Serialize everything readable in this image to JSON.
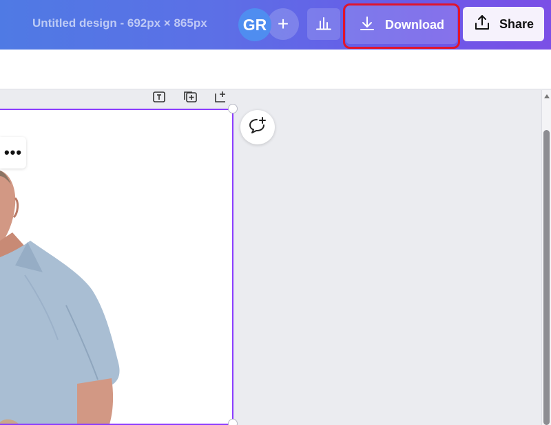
{
  "header": {
    "doc_title": "Untitled design - 692px × 865px",
    "avatar_initials": "GR",
    "add_label": "+",
    "download_label": "Download",
    "share_label": "Share"
  },
  "canvas": {
    "more_label": "•••"
  },
  "colors": {
    "header_start": "#4f7ae4",
    "header_end": "#7b4fe6",
    "selection": "#8b3dff",
    "highlight": "#e0142c"
  },
  "icons": {
    "insights": "bar-chart-icon",
    "download": "download-arrow-icon",
    "share": "share-upload-icon",
    "comment": "add-comment-icon",
    "page_actions": [
      "add-note-icon",
      "duplicate-page-icon",
      "add-page-icon"
    ]
  }
}
